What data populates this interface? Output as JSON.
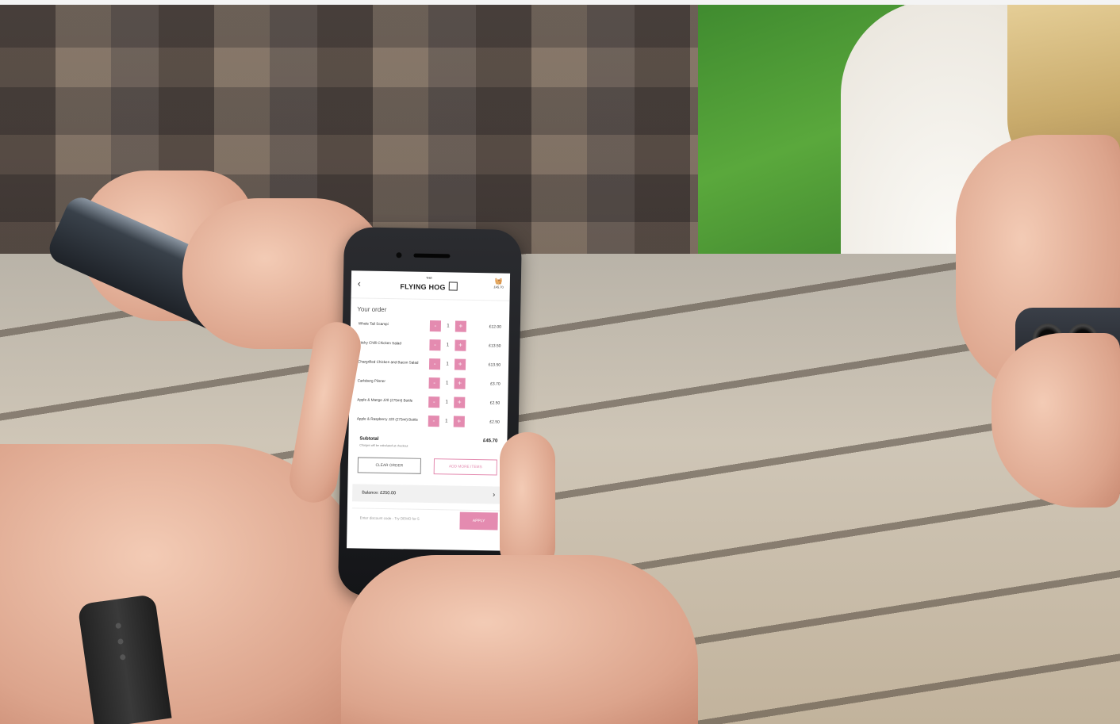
{
  "app": {
    "logo_small": "THE",
    "logo_brand": "FLYING HOG",
    "back_icon": "‹",
    "basket_total": "£45.70",
    "order_title": "Your order",
    "items": [
      {
        "name": "Whole Tail Scampi",
        "qty": "1",
        "price": "£12.00"
      },
      {
        "name": "Sticky Chilli Chicken Salad",
        "qty": "1",
        "price": "£13.50"
      },
      {
        "name": "Chargrilled Chicken and Bacon Salad",
        "qty": "1",
        "price": "£13.50"
      },
      {
        "name": "Carlsberg Pilsner",
        "qty": "1",
        "price": "£3.70"
      },
      {
        "name": "Apple & Mango J20 (275ml) Bottle",
        "qty": "1",
        "price": "£2.50"
      },
      {
        "name": "Apple & Raspberry J20 (275ml) Bottle",
        "qty": "1",
        "price": "£2.50"
      }
    ],
    "minus_label": "-",
    "plus_label": "+",
    "subtotal_label": "Subtotal",
    "subtotal_note": "Charges will be calculated at checkout",
    "subtotal_value": "£45.70",
    "clear_order": "CLEAR ORDER",
    "add_more": "ADD MORE ITEMS",
    "balance": "Balance: £250.00",
    "balance_chevron": "›",
    "discount_placeholder": "Enter discount code - Try DEMO for 5",
    "apply": "APPLY"
  },
  "colors": {
    "accent": "#e48bb0"
  }
}
